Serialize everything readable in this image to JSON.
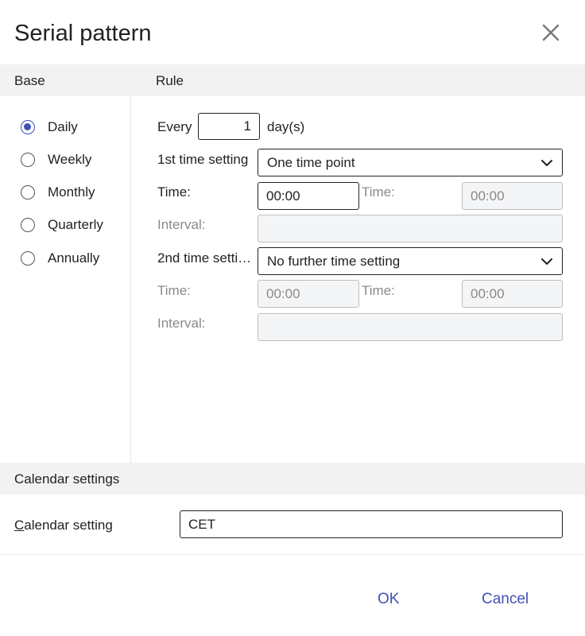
{
  "dialog": {
    "title": "Serial pattern"
  },
  "headers": {
    "base": "Base",
    "rule": "Rule"
  },
  "base_options": [
    {
      "label": "Daily",
      "checked": true
    },
    {
      "label": "Weekly",
      "checked": false
    },
    {
      "label": "Monthly",
      "checked": false
    },
    {
      "label": "Quarterly",
      "checked": false
    },
    {
      "label": "Annually",
      "checked": false
    }
  ],
  "rule": {
    "every_label": "Every",
    "every_value": "1",
    "unit": "day(s)",
    "first_time_setting_label": "1st time setting",
    "first_time_setting_value": "One time point",
    "time1_label": "Time:",
    "time1_value": "00:00",
    "time1b_label": "Time:",
    "time1b_value": "00:00",
    "interval1_label": "Interval:",
    "interval1_value": "",
    "second_time_setting_label": "2nd time setti…",
    "second_time_setting_value": "No further time setting",
    "time2_label": "Time:",
    "time2_value": "00:00",
    "time2b_label": "Time:",
    "time2b_value": "00:00",
    "interval2_label": "Interval:",
    "interval2_value": ""
  },
  "calendar": {
    "section_title": "Calendar settings",
    "setting_label": "Calendar setting",
    "setting_value": "CET"
  },
  "footer": {
    "ok": "OK",
    "cancel": "Cancel"
  },
  "colors": {
    "accent": "#3f51b5",
    "band": "#f2f2f2",
    "disabled_text": "#8a8a8a"
  }
}
